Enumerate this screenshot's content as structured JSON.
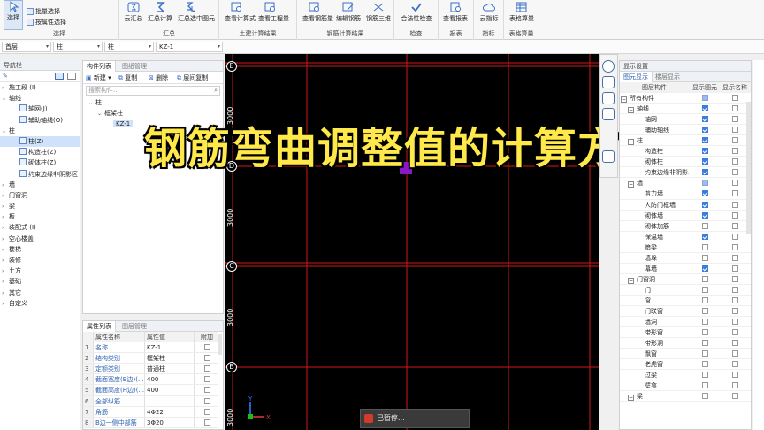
{
  "ribbon": {
    "select_group": {
      "label": "选择",
      "select_btn": "选择",
      "batch_select": "批量选择",
      "attr_select": "按属性选择"
    },
    "summary_group": {
      "label": "汇总",
      "cloud_summary": "云汇总",
      "summary_calc": "汇总计算",
      "summary_selected": "汇总选中图元"
    },
    "civil_group": {
      "label": "土建计算结果",
      "view_formula": "查看计算式",
      "view_quantity": "查看工程量"
    },
    "rebar_group": {
      "label": "钢筋计算结果",
      "view_rebar": "查看钢筋量",
      "edit_rebar": "编辑钢筋",
      "rebar_3d": "钢筋三维"
    },
    "check_group": {
      "label": "检查",
      "validity_check": "合法性检查"
    },
    "report_group": {
      "label": "报表",
      "view_report": "查看报表"
    },
    "index_group": {
      "label": "指标",
      "cloud_index": "云指标"
    },
    "table_group": {
      "label": "表格算量",
      "table_calc": "表格算量"
    }
  },
  "combos": [
    "首层",
    "柱",
    "柱",
    "KZ-1"
  ],
  "nav": {
    "title": "导航栏",
    "items": [
      {
        "label": "施工段 (I)",
        "exp": "›",
        "indent": 0
      },
      {
        "label": "轴线",
        "exp": "⌄",
        "indent": 0
      },
      {
        "label": "轴网(J)",
        "exp": "",
        "indent": 1
      },
      {
        "label": "辅助轴线(O)",
        "exp": "",
        "indent": 1
      },
      {
        "label": "柱",
        "exp": "⌄",
        "indent": 0
      },
      {
        "label": "柱(Z)",
        "exp": "",
        "indent": 1,
        "selected": true
      },
      {
        "label": "构造柱(Z)",
        "exp": "",
        "indent": 1
      },
      {
        "label": "砌体柱(Z)",
        "exp": "",
        "indent": 1
      },
      {
        "label": "约束边缘非阴影区",
        "exp": "",
        "indent": 1
      },
      {
        "label": "墙",
        "exp": "›",
        "indent": 0
      },
      {
        "label": "门窗洞",
        "exp": "›",
        "indent": 0
      },
      {
        "label": "梁",
        "exp": "›",
        "indent": 0
      },
      {
        "label": "板",
        "exp": "›",
        "indent": 0
      },
      {
        "label": "装配式 (I)",
        "exp": "›",
        "indent": 0
      },
      {
        "label": "空心楼盖",
        "exp": "›",
        "indent": 0
      },
      {
        "label": "楼梯",
        "exp": "›",
        "indent": 0
      },
      {
        "label": "装修",
        "exp": "›",
        "indent": 0
      },
      {
        "label": "土方",
        "exp": "›",
        "indent": 0
      },
      {
        "label": "基础",
        "exp": "›",
        "indent": 0
      },
      {
        "label": "其它",
        "exp": "›",
        "indent": 0
      },
      {
        "label": "自定义",
        "exp": "›",
        "indent": 0
      }
    ]
  },
  "comp_panel": {
    "tab_active": "构件列表",
    "tab_inactive": "图纸管理",
    "new_btn": "新建",
    "copy_btn": "复制",
    "delete_btn": "删除",
    "floor_copy_btn": "层间复制",
    "search_placeholder": "搜索构件...",
    "tree": [
      {
        "label": "柱",
        "exp": "⌄",
        "indent": 0
      },
      {
        "label": "框架柱",
        "exp": "⌄",
        "indent": 1
      },
      {
        "label": "KZ-1",
        "exp": "",
        "indent": 2,
        "selected": true
      }
    ]
  },
  "prop_panel": {
    "tab_active": "属性列表",
    "tab_inactive": "图层管理",
    "headers": [
      "",
      "属性名称",
      "属性值",
      "附加"
    ],
    "rows": [
      {
        "no": "1",
        "name": "名称",
        "value": "KZ-1",
        "extra": false
      },
      {
        "no": "2",
        "name": "结构类别",
        "value": "框架柱",
        "extra": false
      },
      {
        "no": "3",
        "name": "定额类别",
        "value": "普通柱",
        "extra": false
      },
      {
        "no": "4",
        "name": "截面宽度(B边)(...",
        "value": "400",
        "extra": false
      },
      {
        "no": "5",
        "name": "截面高度(H边)(...",
        "value": "400",
        "extra": false
      },
      {
        "no": "6",
        "name": "全部纵筋",
        "value": "",
        "extra": false
      },
      {
        "no": "7",
        "name": "角筋",
        "value": "4Φ22",
        "extra": false
      },
      {
        "no": "8",
        "name": "B边一侧中部筋",
        "value": "3Φ20",
        "extra": false
      }
    ]
  },
  "canvas": {
    "axis_labels": [
      "E",
      "D",
      "C",
      "B"
    ],
    "dims": [
      "3000",
      "3000",
      "3000",
      "3000"
    ],
    "overlay_title": "钢筋弯曲调整值的计算方法",
    "status_popup": "已暂停...",
    "colors": {
      "grid": "#d01818",
      "background": "#000000",
      "marker": "#8a18c8",
      "overlay": "#ffe84a"
    }
  },
  "display_panel": {
    "title": "显示设置",
    "tab_active": "图元显示",
    "tab_inactive": "楼层显示",
    "headers": [
      "图层构件",
      "显示图元",
      "显示名称"
    ],
    "rows": [
      {
        "label": "所有构件",
        "level": 0,
        "grp": true,
        "a": "partial",
        "b": false
      },
      {
        "label": "轴线",
        "level": 1,
        "grp": true,
        "a": true,
        "b": false
      },
      {
        "label": "轴网",
        "level": 2,
        "grp": false,
        "a": true,
        "b": false
      },
      {
        "label": "辅助轴线",
        "level": 2,
        "grp": false,
        "a": true,
        "b": false
      },
      {
        "label": "柱",
        "level": 1,
        "grp": true,
        "a": true,
        "b": false
      },
      {
        "label": "构造柱",
        "level": 2,
        "grp": false,
        "a": true,
        "b": false
      },
      {
        "label": "砌体柱",
        "level": 2,
        "grp": false,
        "a": true,
        "b": false
      },
      {
        "label": "约束边缘非阴影...",
        "level": 2,
        "grp": false,
        "a": true,
        "b": false
      },
      {
        "label": "墙",
        "level": 1,
        "grp": true,
        "a": "partial",
        "b": false
      },
      {
        "label": "剪力墙",
        "level": 2,
        "grp": false,
        "a": true,
        "b": false
      },
      {
        "label": "人防门框墙",
        "level": 2,
        "grp": false,
        "a": true,
        "b": false
      },
      {
        "label": "砌体墙",
        "level": 2,
        "grp": false,
        "a": true,
        "b": false
      },
      {
        "label": "砌体加筋",
        "level": 2,
        "grp": false,
        "a": false,
        "b": false
      },
      {
        "label": "保温墙",
        "level": 2,
        "grp": false,
        "a": true,
        "b": false
      },
      {
        "label": "暗梁",
        "level": 2,
        "grp": false,
        "a": false,
        "b": false
      },
      {
        "label": "墙垛",
        "level": 2,
        "grp": false,
        "a": false,
        "b": false
      },
      {
        "label": "幕墙",
        "level": 2,
        "grp": false,
        "a": true,
        "b": false
      },
      {
        "label": "门窗洞",
        "level": 1,
        "grp": true,
        "a": false,
        "b": false
      },
      {
        "label": "门",
        "level": 2,
        "grp": false,
        "a": false,
        "b": false
      },
      {
        "label": "窗",
        "level": 2,
        "grp": false,
        "a": false,
        "b": false
      },
      {
        "label": "门联窗",
        "level": 2,
        "grp": false,
        "a": false,
        "b": false
      },
      {
        "label": "墙洞",
        "level": 2,
        "grp": false,
        "a": false,
        "b": false
      },
      {
        "label": "带形窗",
        "level": 2,
        "grp": false,
        "a": false,
        "b": false
      },
      {
        "label": "带形洞",
        "level": 2,
        "grp": false,
        "a": false,
        "b": false
      },
      {
        "label": "飘窗",
        "level": 2,
        "grp": false,
        "a": false,
        "b": false
      },
      {
        "label": "老虎窗",
        "level": 2,
        "grp": false,
        "a": false,
        "b": false
      },
      {
        "label": "过梁",
        "level": 2,
        "grp": false,
        "a": false,
        "b": false
      },
      {
        "label": "壁龛",
        "level": 2,
        "grp": false,
        "a": false,
        "b": false
      },
      {
        "label": "梁",
        "level": 1,
        "grp": true,
        "a": false,
        "b": false
      }
    ]
  }
}
